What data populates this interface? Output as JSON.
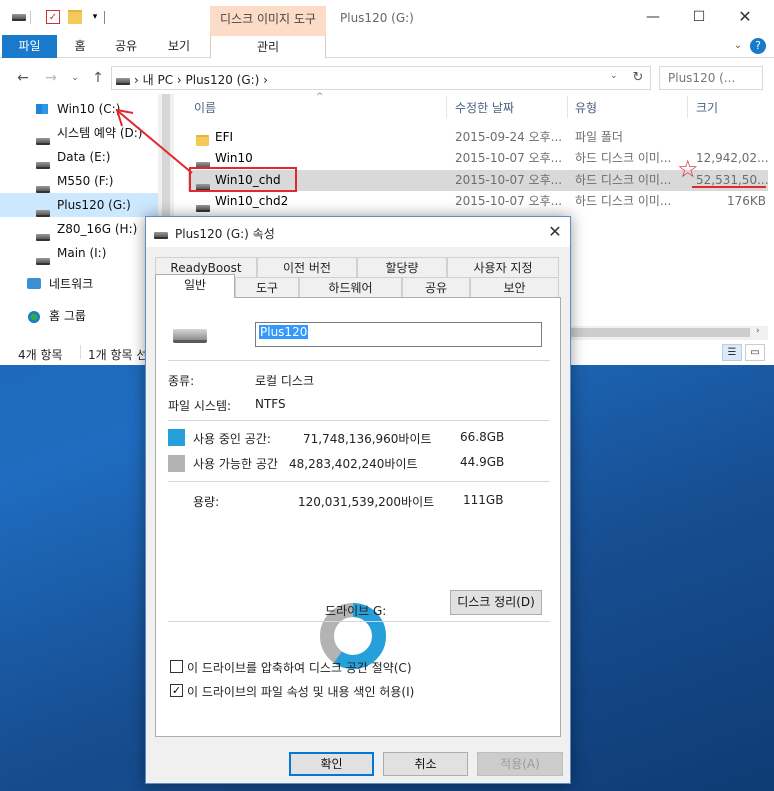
{
  "explorer": {
    "context_tab_header": "디스크 이미지 도구",
    "window_title": "Plus120 (G:)",
    "ribbon": {
      "file_tab": "파일",
      "home_tab": "홈",
      "share_tab": "공유",
      "view_tab": "보기",
      "manage_tab": "관리"
    },
    "address": {
      "path": "›  내 PC  ›  Plus120 (G:)  ›",
      "search_placeholder": "Plus120 (..."
    },
    "nav_items": [
      {
        "label": "Win10 (C:)",
        "icon": "windows-drive-icon"
      },
      {
        "label": "시스템 예약 (D:)",
        "icon": "drive-icon"
      },
      {
        "label": "Data (E:)",
        "icon": "drive-icon"
      },
      {
        "label": "M550 (F:)",
        "icon": "drive-icon"
      },
      {
        "label": "Plus120 (G:)",
        "icon": "drive-icon",
        "selected": true
      },
      {
        "label": "Z80_16G (H:)",
        "icon": "drive-icon"
      },
      {
        "label": "Main (I:)",
        "icon": "drive-icon"
      },
      {
        "label": "네트워크",
        "icon": "network-icon"
      },
      {
        "label": "홈 그룹",
        "icon": "homegroup-icon"
      }
    ],
    "columns": {
      "name": "이름",
      "date": "수정한 날짜",
      "type": "유형",
      "size": "크기"
    },
    "files": [
      {
        "name": "EFI",
        "date": "2015-09-24 오후...",
        "type": "파일 폴더",
        "size": "",
        "icon": "folder-icon"
      },
      {
        "name": "Win10",
        "date": "2015-10-07 오후...",
        "type": "하드 디스크 이미...",
        "size": "12,942,02...",
        "icon": "vhd-icon"
      },
      {
        "name": "Win10_chd",
        "date": "2015-10-07 오후...",
        "type": "하드 디스크 이미...",
        "size": "52,531,50...",
        "icon": "vhd-icon",
        "selected": true
      },
      {
        "name": "Win10_chd2",
        "date": "2015-10-07 오후...",
        "type": "하드 디스크 이미...",
        "size": "176KB",
        "icon": "vhd-icon"
      }
    ],
    "status": {
      "item_count": "4개 항목",
      "selected_count": "1개 항목 선"
    }
  },
  "dialog": {
    "title": "Plus120 (G:) 속성",
    "tabs_row1": [
      "ReadyBoost",
      "이전 버전",
      "할당량",
      "사용자 지정"
    ],
    "tabs_row2": [
      "일반",
      "도구",
      "하드웨어",
      "공유",
      "보안"
    ],
    "volume_name": "Plus120",
    "type_label": "종류:",
    "type_value": "로컬 디스크",
    "fs_label": "파일 시스템:",
    "fs_value": "NTFS",
    "used_label": "사용 중인 공간:",
    "used_bytes": "71,748,136,960바이트",
    "used_gb": "66.8GB",
    "free_label": "사용 가능한 공간",
    "free_bytes": "48,283,402,240바이트",
    "free_gb": "44.9GB",
    "capacity_label": "용량:",
    "capacity_bytes": "120,031,539,200바이트",
    "capacity_gb": "111GB",
    "drive_label": "드라이브 G:",
    "cleanup_button": "디스크 정리(D)",
    "compress_label": "이 드라이브를 압축하여 디스크 공간 절약(C)",
    "compress_checked": false,
    "index_label": "이 드라이브의 파일 속성 및 내용 색인 허용(I)",
    "index_checked": true,
    "ok_button": "확인",
    "cancel_button": "취소",
    "apply_button": "적용(A)",
    "used_fraction": 0.598,
    "colors": {
      "used": "#26a0da",
      "free": "#b3b3b3"
    }
  },
  "annotations": {
    "color": "#e0282d"
  }
}
